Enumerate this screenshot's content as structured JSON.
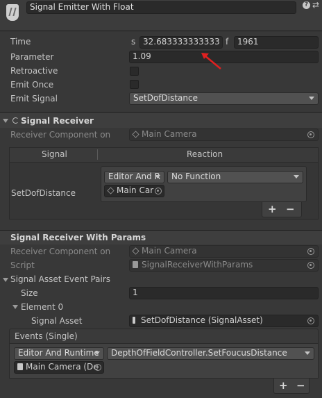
{
  "header": {
    "title": "Signal Emitter With Float",
    "help_glyph": "?",
    "settings_glyph": "⇄"
  },
  "emitter": {
    "time_label": "Time",
    "time_seconds_prefix": "s",
    "time_seconds_value": "32.683333333333",
    "time_frames_prefix": "f",
    "time_frames_value": "1961",
    "parameter_label": "Parameter",
    "parameter_value": "1.09",
    "retroactive_label": "Retroactive",
    "emit_once_label": "Emit Once",
    "emit_signal_label": "Emit Signal",
    "emit_signal_value": "SetDofDistance"
  },
  "signal_receiver": {
    "title": "Signal Receiver",
    "receiver_component_label": "Receiver Component on",
    "receiver_component_value": "Main Camera",
    "col_signal": "Signal",
    "col_reaction": "Reaction",
    "row_signal": "SetDofDistance",
    "runtime_mode": "Editor And R",
    "function_value": "No Function",
    "object_value": "Main Car",
    "add_label": "+",
    "remove_label": "−"
  },
  "signal_receiver_params": {
    "title": "Signal Receiver With Params",
    "receiver_component_label": "Receiver Component on",
    "receiver_component_value": "Main Camera",
    "script_label": "Script",
    "script_value": "SignalReceiverWithParams",
    "pairs_label": "Signal Asset Event Pairs",
    "size_label": "Size",
    "size_value": "1",
    "element_label": "Element 0",
    "signal_asset_label": "Signal Asset",
    "signal_asset_value": "SetDofDistance (SignalAsset)",
    "events_label": "Events (Single)",
    "runtime_mode": "Editor And Runtime",
    "function_value": "DepthOfFieldController.SetFoucusDistance",
    "object_value": "Main Camera (De",
    "add_label": "+",
    "remove_label": "−"
  },
  "colors": {
    "background": "#383838",
    "field": "#2a2a2a",
    "annotation_arrow": "#e02020"
  }
}
